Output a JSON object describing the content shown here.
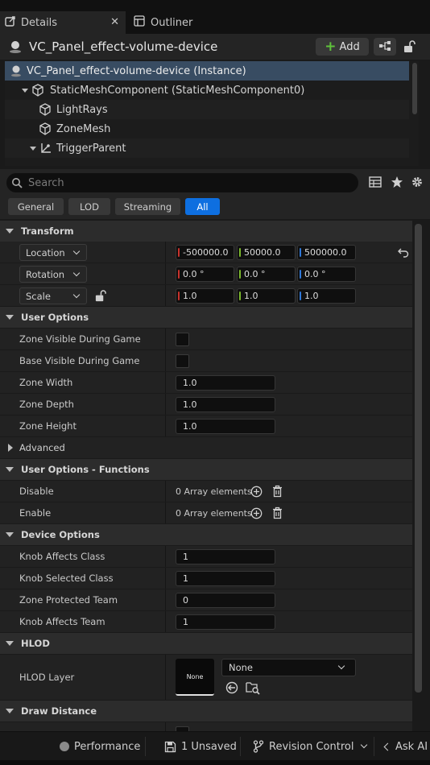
{
  "tabs": {
    "details": "Details",
    "outliner": "Outliner",
    "close": "✕"
  },
  "actor": {
    "name": "VC_Panel_effect-volume-device",
    "add_label": "Add"
  },
  "components": [
    "VC_Panel_effect-volume-device (Instance)",
    "StaticMeshComponent (StaticMeshComponent0)",
    "LightRays",
    "ZoneMesh",
    "TriggerParent"
  ],
  "search": {
    "placeholder": "Search"
  },
  "filters": [
    "General",
    "LOD",
    "Streaming",
    "All"
  ],
  "transform": {
    "title": "Transform",
    "location": {
      "label": "Location",
      "x": "-500000.0",
      "y": "50000.0",
      "z": "500000.0"
    },
    "rotation": {
      "label": "Rotation",
      "x": "0.0 °",
      "y": "0.0 °",
      "z": "0.0 °"
    },
    "scale": {
      "label": "Scale",
      "x": "1.0",
      "y": "1.0",
      "z": "1.0"
    }
  },
  "user_options": {
    "title": "User Options",
    "zone_visible": "Zone Visible During Game",
    "base_visible": "Base Visible During Game",
    "zone_width": {
      "label": "Zone Width",
      "value": "1.0"
    },
    "zone_depth": {
      "label": "Zone Depth",
      "value": "1.0"
    },
    "zone_height": {
      "label": "Zone Height",
      "value": "1.0"
    },
    "advanced": "Advanced"
  },
  "functions": {
    "title": "User Options - Functions",
    "disable": {
      "label": "Disable",
      "value": "0 Array elements"
    },
    "enable": {
      "label": "Enable",
      "value": "0 Array elements"
    }
  },
  "device_options": {
    "title": "Device Options",
    "knob_affects_class": {
      "label": "Knob Affects Class",
      "value": "1"
    },
    "knob_selected_class": {
      "label": "Knob Selected Class",
      "value": "1"
    },
    "zone_protected_team": {
      "label": "Zone Protected Team",
      "value": "0"
    },
    "knob_affects_team": {
      "label": "Knob Affects Team",
      "value": "1"
    }
  },
  "hlod": {
    "title": "HLOD",
    "layer_label": "HLOD Layer",
    "thumb": "None",
    "value": "None"
  },
  "draw_distance": {
    "title": "Draw Distance"
  },
  "statusbar": {
    "performance": "Performance",
    "unsaved": "1 Unsaved",
    "revision": "Revision Control",
    "ask_ai": "Ask AI"
  },
  "colors": {
    "accent": "#0e6fe0",
    "axis_x": "#c8322c",
    "axis_y": "#7ab82c",
    "axis_z": "#2f78d8",
    "add_plus": "#5fc23b"
  }
}
